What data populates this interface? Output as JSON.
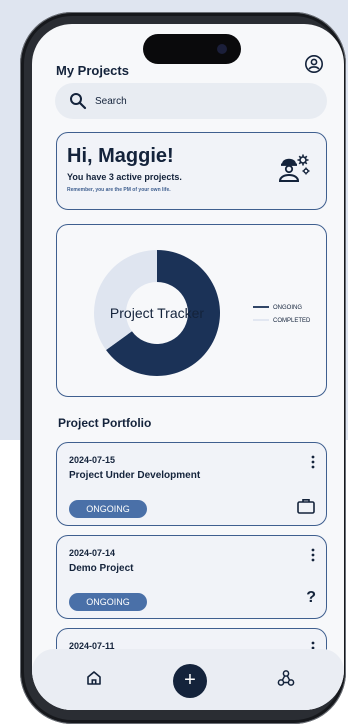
{
  "header": {
    "title": "My Projects",
    "profile_icon": "user-circle-icon"
  },
  "search": {
    "placeholder": "Search",
    "icon": "search-icon"
  },
  "greeting": {
    "hello": "Hi, Maggie!",
    "active_projects": "You have 3 active projects.",
    "motto": "Remember, you are the PM of your own life.",
    "icon": "worker-gears-icon"
  },
  "chart_data": {
    "type": "pie",
    "title": "Project Tracker",
    "categories": [
      "ONGOING",
      "COMPLETED"
    ],
    "values": [
      65,
      35
    ],
    "colors": [
      "#1b3257",
      "#dfe5f0"
    ],
    "legend_position": "right"
  },
  "portfolio": {
    "title": "Project Portfolio",
    "projects": [
      {
        "date": "2024-07-15",
        "name": "Project Under Development",
        "status": "ONGOING",
        "icon": "briefcase-icon"
      },
      {
        "date": "2024-07-14",
        "name": "Demo Project",
        "status": "ONGOING",
        "icon": "question-icon",
        "icon_text": "?"
      },
      {
        "date": "2024-07-11"
      }
    ]
  },
  "bottom_nav": {
    "home_icon": "home-icon",
    "add_label": "+",
    "team_icon": "team-icon"
  },
  "colors": {
    "navy": "#14233b",
    "accent": "#4a70a8",
    "border": "#3f5f8f",
    "card": "#f1f3f8"
  }
}
